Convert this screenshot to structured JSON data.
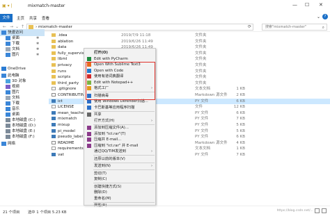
{
  "titlebar": {
    "title": "mixmatch-master",
    "minimize": "—",
    "maximize": "☐",
    "close": "✕"
  },
  "ribbon": {
    "tabs": [
      "文件",
      "主页",
      "共享",
      "查看"
    ]
  },
  "address": {
    "path": "› mixmatch-master",
    "search_placeholder": "搜索\"mixmatch-master\""
  },
  "sidebar": {
    "items": [
      {
        "label": "快速访问",
        "icon": "star-icon",
        "color": "#3a86d8"
      },
      {
        "label": "桌面",
        "icon": "desktop-icon",
        "color": "#3a86d8"
      },
      {
        "label": "下载",
        "icon": "download-icon",
        "color": "#3a86d8"
      },
      {
        "label": "文档",
        "icon": "document-icon",
        "color": "#9aa8b8"
      },
      {
        "label": "图片",
        "icon": "picture-icon",
        "color": "#3a86d8"
      },
      {
        "label": "OneDrive",
        "icon": "cloud-icon",
        "color": "#2b7cd3"
      },
      {
        "label": "此电脑",
        "icon": "computer-icon",
        "color": "#3a86d8"
      },
      {
        "label": "3D 对象",
        "icon": "cube-icon",
        "color": "#4aa3df"
      },
      {
        "label": "视频",
        "icon": "video-icon",
        "color": "#7a5fc8"
      },
      {
        "label": "图片",
        "icon": "picture-icon",
        "color": "#3a86d8"
      },
      {
        "label": "文档",
        "icon": "document-icon",
        "color": "#9aa8b8"
      },
      {
        "label": "下载",
        "icon": "download-icon",
        "color": "#3a86d8"
      },
      {
        "label": "音乐",
        "icon": "music-icon",
        "color": "#3a86d8"
      },
      {
        "label": "桌面",
        "icon": "desktop-icon",
        "color": "#3a86d8"
      },
      {
        "label": "本地磁盘 (C:)",
        "icon": "drive-icon",
        "color": "#7d8b99"
      },
      {
        "label": "本地磁盘 (D:)",
        "icon": "drive-icon",
        "color": "#7d8b99"
      },
      {
        "label": "本地磁盘 (E:)",
        "icon": "drive-icon",
        "color": "#7d8b99"
      },
      {
        "label": "本地磁盘 (F:)",
        "icon": "drive-icon",
        "color": "#7d8b99"
      },
      {
        "label": "网络",
        "icon": "network-icon",
        "color": "#3a86d8"
      }
    ]
  },
  "files": [
    {
      "name": ".idea",
      "date": "2019/7/9 11:18",
      "type": "文件夹",
      "size": "",
      "kind": "folder"
    },
    {
      "name": "ablation",
      "date": "2019/6/26 11:49",
      "type": "文件夹",
      "size": "",
      "kind": "folder"
    },
    {
      "name": "data",
      "date": "2019/6/26 11:49",
      "type": "文件夹",
      "size": "",
      "kind": "folder"
    },
    {
      "name": "fully_supervised",
      "date": "",
      "type": "文件夹",
      "size": "",
      "kind": "folder"
    },
    {
      "name": "libml",
      "date": "",
      "type": "文件夹",
      "size": "",
      "kind": "folder"
    },
    {
      "name": "privacy",
      "date": "",
      "type": "文件夹",
      "size": "",
      "kind": "folder"
    },
    {
      "name": "runs",
      "date": "",
      "type": "文件夹",
      "size": "",
      "kind": "folder"
    },
    {
      "name": "scripts",
      "date": "",
      "type": "文件夹",
      "size": "",
      "kind": "folder"
    },
    {
      "name": "third_party",
      "date": "",
      "type": "文件夹",
      "size": "",
      "kind": "folder"
    },
    {
      "name": ".gitignore",
      "date": "",
      "type": "文本文档",
      "size": "1 KB",
      "kind": "doc"
    },
    {
      "name": "CONTRIBUTING",
      "date": "",
      "type": "Markdown 源文件",
      "size": "2 KB",
      "kind": "md"
    },
    {
      "name": "ict",
      "date": "",
      "type": "PY 文件",
      "size": "6 KB",
      "kind": "py"
    },
    {
      "name": "LICENSE",
      "date": "",
      "type": "文件",
      "size": "12 KB",
      "kind": "doc"
    },
    {
      "name": "mean_teacher",
      "date": "",
      "type": "PY 文件",
      "size": "6 KB",
      "kind": "py"
    },
    {
      "name": "mixmatch",
      "date": "",
      "type": "PY 文件",
      "size": "7 KB",
      "kind": "py"
    },
    {
      "name": "mixup",
      "date": "",
      "type": "PY 文件",
      "size": "5 KB",
      "kind": "py"
    },
    {
      "name": "pi_model",
      "date": "",
      "type": "PY 文件",
      "size": "5 KB",
      "kind": "py"
    },
    {
      "name": "pseudo_label",
      "date": "",
      "type": "PY 文件",
      "size": "6 KB",
      "kind": "py"
    },
    {
      "name": "README",
      "date": "",
      "type": "Markdown 源文件",
      "size": "4 KB",
      "kind": "md"
    },
    {
      "name": "requirements",
      "date": "",
      "type": "文本文档",
      "size": "1 KB",
      "kind": "doc"
    },
    {
      "name": "vat",
      "date": "",
      "type": "PY 文件",
      "size": "7 KB",
      "kind": "py"
    }
  ],
  "context_menu": {
    "items": [
      {
        "label": "打开(O)",
        "bold": true,
        "icon": "",
        "arrow": false,
        "sep_after": false
      },
      {
        "label": "Edit with PyCharm",
        "icon": "pycharm-icon",
        "color": "#1c8b3d",
        "arrow": false,
        "sep_after": false
      },
      {
        "label": "Open With Sublime Text3",
        "icon": "sublime-icon",
        "color": "#e86b1c",
        "arrow": false,
        "sep_after": false
      },
      {
        "label": "Open with Code",
        "icon": "vscode-icon",
        "color": "#1f7bd1",
        "arrow": false,
        "sep_after": false
      },
      {
        "label": "使用有道词典翻译",
        "icon": "youdao-icon",
        "color": "#d42a2a",
        "arrow": false,
        "sep_after": false
      },
      {
        "label": "Edit with Notepad++",
        "icon": "notepadpp-icon",
        "color": "#7cb342",
        "arrow": false,
        "sep_after": false
      },
      {
        "label": "格式工厂",
        "icon": "formatfactory-icon",
        "color": "#e59a1b",
        "arrow": true,
        "sep_after": true
      },
      {
        "label": "扫描病毒",
        "icon": "shield-icon",
        "color": "#2a6fc9",
        "arrow": false,
        "sep_after": false
      },
      {
        "label": "使用 Windows Defender扫描...",
        "icon": "defender-icon",
        "color": "#2a6fc9",
        "arrow": false,
        "sep_after": false
      },
      {
        "label": "卡巴斯基等应用程序扫描",
        "icon": "scan-icon",
        "color": "#2a6fc9",
        "arrow": false,
        "sep_after": true
      },
      {
        "label": "共享",
        "icon": "share-icon",
        "color": "#666666",
        "arrow": false,
        "sep_after": false
      },
      {
        "label": "打开方式(H)",
        "icon": "",
        "arrow": true,
        "sep_after": true
      },
      {
        "label": "添加到压缩文件(A)...",
        "icon": "winrar-icon",
        "color": "#8b3a8b",
        "arrow": false,
        "sep_after": false
      },
      {
        "label": "添加到 \"ict.rar\"(T)",
        "icon": "winrar-icon",
        "color": "#8b3a8b",
        "arrow": false,
        "sep_after": false
      },
      {
        "label": "压缩并 E-mail...",
        "icon": "winrar-icon",
        "color": "#8b3a8b",
        "arrow": false,
        "sep_after": false
      },
      {
        "label": "压缩到 \"ict.rar\" 并 E-mail",
        "icon": "winrar-icon",
        "color": "#8b3a8b",
        "arrow": false,
        "sep_after": false
      },
      {
        "label": "通过QQ/TIM发送到",
        "icon": "",
        "arrow": true,
        "sep_after": true
      },
      {
        "label": "还原以前的版本(V)",
        "icon": "",
        "arrow": false,
        "sep_after": true
      },
      {
        "label": "发送到(N)",
        "icon": "",
        "arrow": true,
        "sep_after": true
      },
      {
        "label": "剪切(T)",
        "icon": "",
        "arrow": false,
        "sep_after": false
      },
      {
        "label": "复制(C)",
        "icon": "",
        "arrow": false,
        "sep_after": true
      },
      {
        "label": "创建快捷方式(S)",
        "icon": "",
        "arrow": false,
        "sep_after": false
      },
      {
        "label": "删除(D)",
        "icon": "",
        "arrow": false,
        "sep_after": false
      },
      {
        "label": "重命名(M)",
        "icon": "",
        "arrow": false,
        "sep_after": true
      },
      {
        "label": "属性(R)",
        "icon": "",
        "arrow": false,
        "sep_after": false
      }
    ]
  },
  "status": {
    "count": "21 个项目",
    "selection": "选中 1 个项目  5.23 KB",
    "watermark": "https://blog.csdn.net/..."
  },
  "colors": {
    "accent": "#1a6fc7",
    "highlight_box": "#e0302a",
    "selection": "#cce8ff"
  }
}
